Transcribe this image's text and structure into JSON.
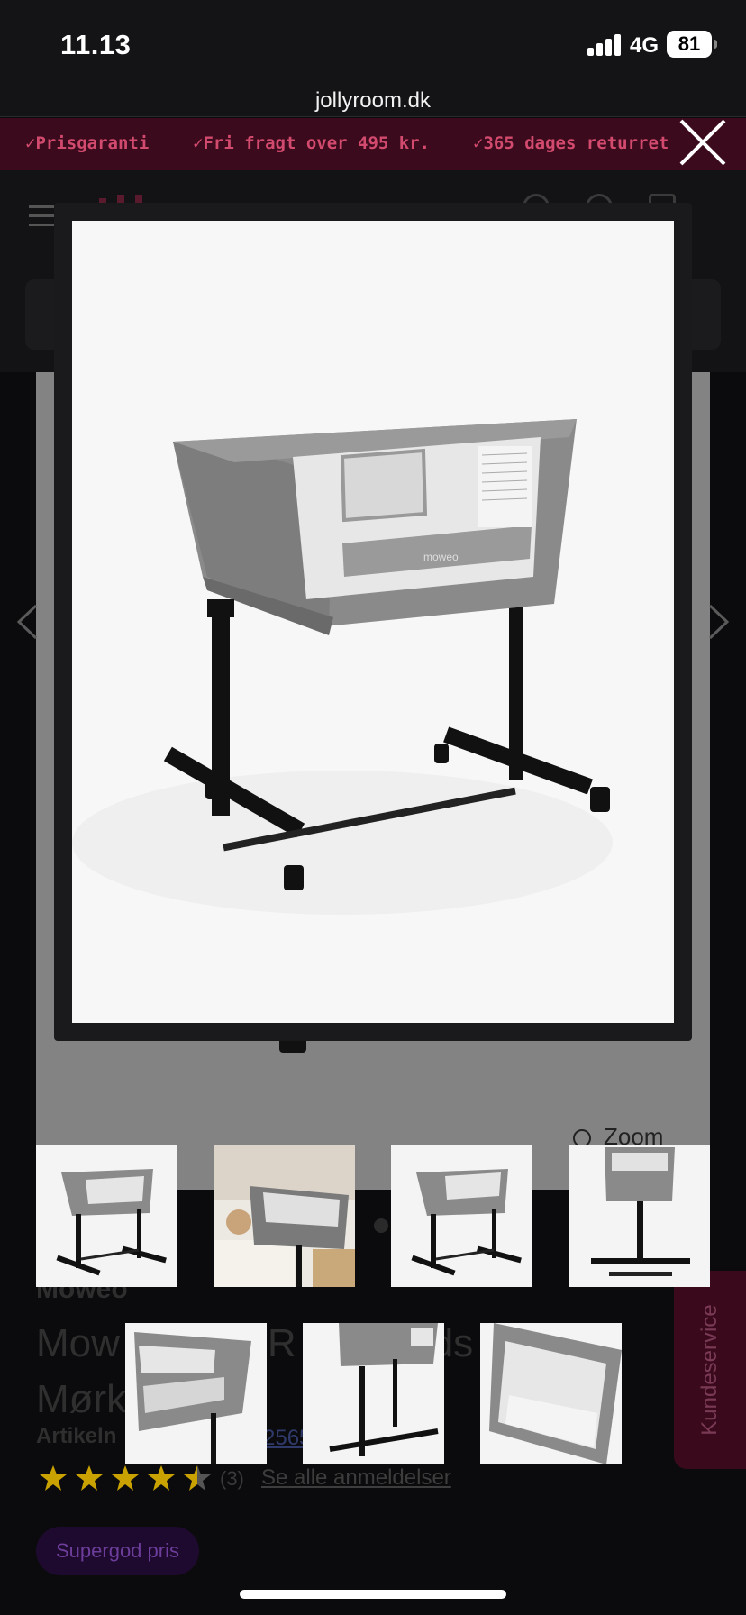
{
  "status_bar": {
    "time": "11.13",
    "network": "4G",
    "battery": "81"
  },
  "browser": {
    "url": "jollyroom.dk"
  },
  "promo": {
    "items": [
      "✓Prisgaranti",
      "✓Fri fragt over 495 kr.",
      "✓365 dages returret"
    ]
  },
  "gallery": {
    "zoom_label": "Zoom"
  },
  "product": {
    "brand": "Moweo",
    "title_line1": "Mow",
    "title_mid": "R",
    "title_end": "ds",
    "title_comma": ",",
    "title_line2": "Mørk",
    "artikel_label": "Artikeln",
    "artikel_number": "2565",
    "review_count": "(3)",
    "reviews_link": "Se alle anmeldelser",
    "badge": "Supergod pris",
    "rating": 4.5,
    "image_logo_text": "moweo"
  },
  "side_tab": {
    "label": "Kundeservice"
  },
  "colors": {
    "promo_bg": "#3b0a1c",
    "promo_text": "#d24a6e",
    "star": "#c9a200",
    "modal_bg": "#1a1a1c"
  }
}
